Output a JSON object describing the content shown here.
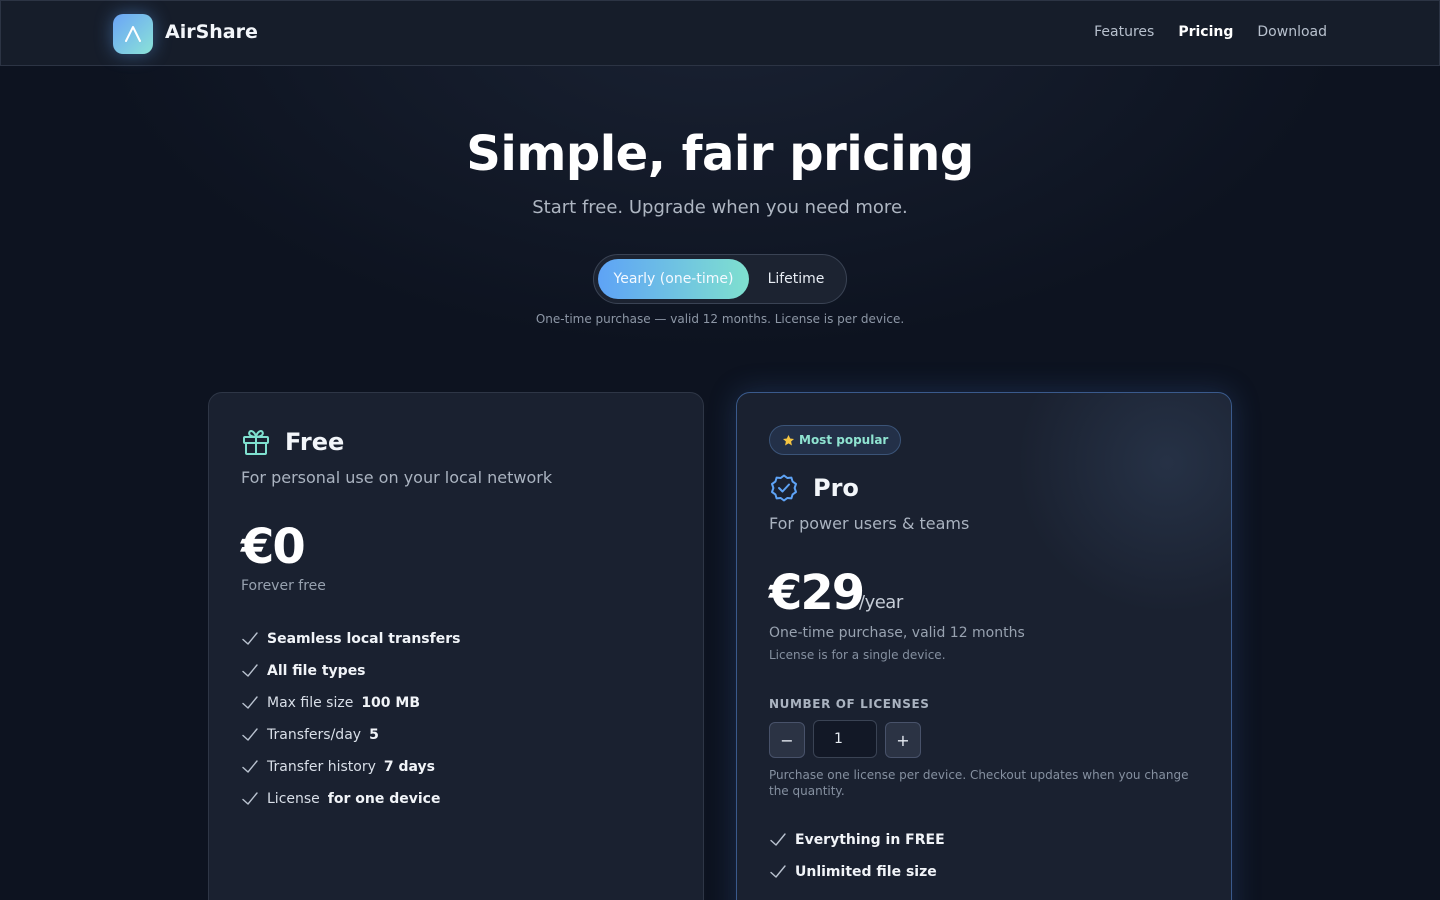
{
  "brand": {
    "name": "AirShare"
  },
  "nav": {
    "links": [
      {
        "label": "Features",
        "active": false
      },
      {
        "label": "Pricing",
        "active": true
      },
      {
        "label": "Download",
        "active": false
      }
    ]
  },
  "hero": {
    "title": "Simple, fair pricing",
    "subtitle": "Start free. Upgrade when you need more."
  },
  "billing_toggle": {
    "options": [
      "Yearly (one-time)",
      "Lifetime"
    ],
    "selected": "Yearly (one-time)",
    "note": "One-time purchase — valid 12 months. License is per device."
  },
  "plans": {
    "free": {
      "name": "Free",
      "description": "For personal use on your local network",
      "price": "€0",
      "price_note": "Forever free",
      "features": [
        {
          "key": "Seamless local transfers",
          "value": ""
        },
        {
          "key": "All file types",
          "value": ""
        },
        {
          "key": "Max file size",
          "value": "100 MB"
        },
        {
          "key": "Transfers/day",
          "value": "5"
        },
        {
          "key": "Transfer history",
          "value": "7 days"
        },
        {
          "key": "License",
          "value": "for one device"
        }
      ]
    },
    "pro": {
      "badge": "Most popular",
      "name": "Pro",
      "description": "For power users & teams",
      "price": "€29",
      "price_unit": "/year",
      "price_note": "One-time purchase, valid 12 months",
      "price_note_small": "License is for a single device.",
      "licenses": {
        "label": "NUMBER OF LICENSES",
        "minus_label": "−",
        "plus_label": "+",
        "quantity": "1",
        "help": "Purchase one license per device. Checkout updates when you change the quantity."
      },
      "features": [
        {
          "key": "Everything in FREE",
          "value": ""
        },
        {
          "key": "Unlimited file size",
          "value": ""
        }
      ]
    }
  },
  "colors": {
    "accent_blue": "#5ea3f6",
    "accent_teal": "#7fe0cf",
    "background": "#0d1320",
    "card": "#1a2130"
  },
  "icons": {
    "logo": "triangle-peak-icon",
    "free_plan": "gift-icon",
    "pro_plan": "badge-check-icon",
    "feature": "check-icon",
    "badge": "star-icon"
  }
}
